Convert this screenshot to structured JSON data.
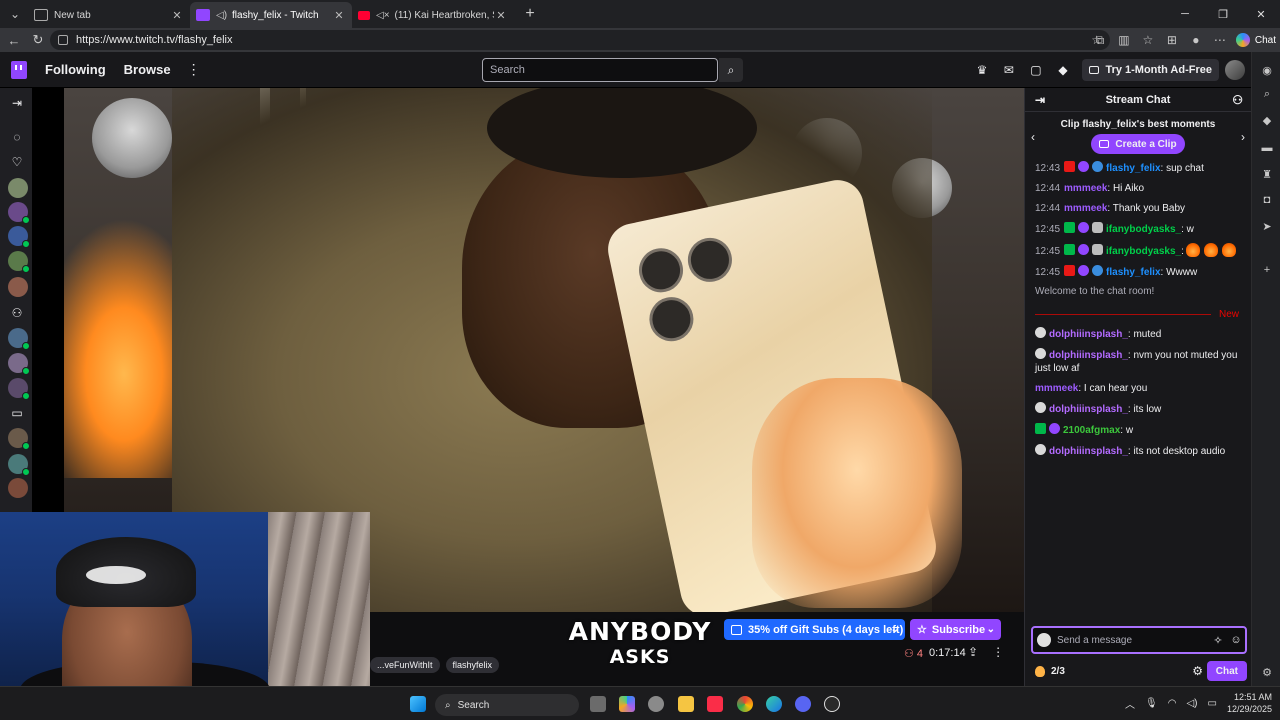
{
  "browser": {
    "tabs": [
      {
        "label": "New tab"
      },
      {
        "label": "flashy_felix - Twitch"
      },
      {
        "label": "(11) Kai Heartbroken, Sketch S"
      }
    ],
    "url": "https://www.twitch.tv/flashy_felix",
    "copilot_label": "Chat"
  },
  "twitch_nav": {
    "following": "Following",
    "browse": "Browse",
    "search_placeholder": "Search",
    "ad_free": "Try 1-Month Ad-Free"
  },
  "stream": {
    "overlay_line1": "ANYBODY",
    "overlay_line2": "ASKS",
    "tags": [
      "...veFunWithIt",
      "flashyfelix"
    ],
    "promo": "35% off Gift Subs (4 days left)",
    "subscribe": "Subscribe",
    "viewers": "4",
    "uptime": "0:17:14"
  },
  "chat": {
    "title": "Stream Chat",
    "clip_title": "Clip flashy_felix's best moments",
    "create_clip": "Create a Clip",
    "messages_top": [
      {
        "ts": "12:43",
        "user": "flashy_felix",
        "text": ": sup chat",
        "color": "#1e90ff",
        "badges": [
          "live",
          "star",
          "prime"
        ]
      },
      {
        "ts": "12:44",
        "user": "mmmeek",
        "text": ": Hi Aiko",
        "color": "#9d5cff",
        "badges": []
      },
      {
        "ts": "12:44",
        "user": "mmmeek",
        "text": ": Thank you Baby",
        "color": "#9d5cff",
        "badges": []
      },
      {
        "ts": "12:45",
        "user": "ifanybodyasks_",
        "text": ": w",
        "color": "#00d04a",
        "badges": [
          "green",
          "star",
          "robot"
        ]
      },
      {
        "ts": "12:45",
        "user": "ifanybodyasks_",
        "text": ":",
        "color": "#00d04a",
        "badges": [
          "green",
          "star",
          "robot"
        ],
        "emotes": 3
      },
      {
        "ts": "12:45",
        "user": "flashy_felix",
        "text": ": Wwww",
        "color": "#1e90ff",
        "badges": [
          "live",
          "star",
          "prime"
        ]
      }
    ],
    "welcome": "Welcome to the chat room!",
    "new_label": "New",
    "messages_new": [
      {
        "user": "dolphiiinsplash_",
        "text": ": muted",
        "color": "#b36bff",
        "badges": [
          "skull"
        ]
      },
      {
        "user": "dolphiiinsplash_",
        "text": ": nvm you not muted you just low af",
        "color": "#b36bff",
        "badges": [
          "skull"
        ]
      },
      {
        "user": "mmmeek",
        "text": ": I can hear you",
        "color": "#9d5cff",
        "badges": []
      },
      {
        "user": "dolphiiinsplash_",
        "text": ": its low",
        "color": "#b36bff",
        "badges": [
          "skull"
        ]
      },
      {
        "user": "2100afgmax",
        "text": ": w",
        "color": "#3cc73c",
        "badges": [
          "green",
          "star"
        ]
      },
      {
        "user": "dolphiiinsplash_",
        "text": ": its not desktop audio",
        "color": "#b36bff",
        "badges": [
          "skull"
        ]
      }
    ],
    "input_placeholder": "Send a message",
    "points": "2/3",
    "chat_button": "Chat"
  },
  "taskbar": {
    "search": "Search",
    "time": "12:51 AM",
    "date": "12/29/2025"
  },
  "colors": {
    "twitch_purple": "#9146ff",
    "promo_blue": "#1f69ff",
    "live_red": "#e91916"
  }
}
